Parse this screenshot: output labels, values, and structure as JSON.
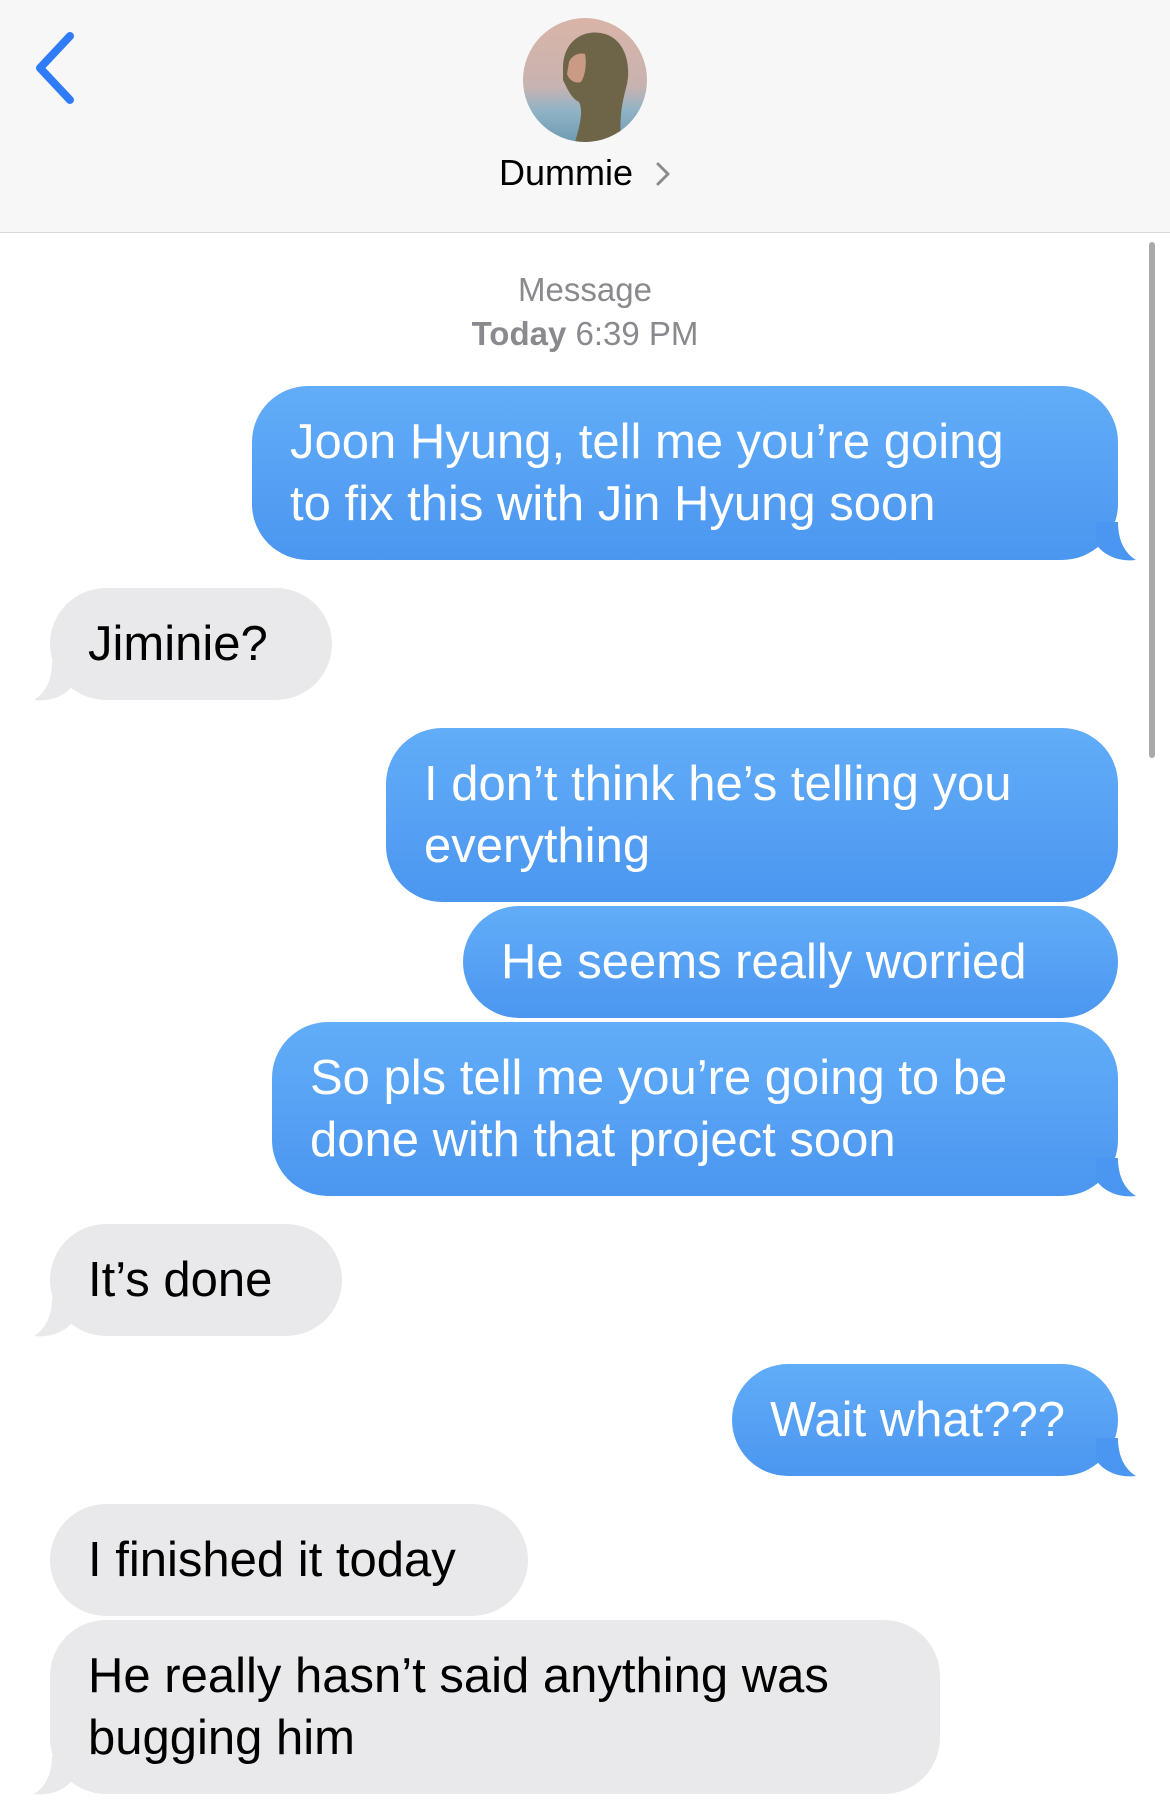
{
  "header": {
    "contact_name": "Dummie",
    "back_icon": "chevron-left-icon",
    "detail_icon": "chevron-right-icon"
  },
  "thread": {
    "service_label": "Message",
    "day_label": "Today",
    "time_label": "6:39 PM"
  },
  "colors": {
    "sent_bubble": "#4b96f0",
    "received_bubble": "#e9e9eb",
    "accent": "#1a73e8"
  },
  "messages": [
    {
      "from": "me",
      "lines": [
        "Joon Hyung, tell me you’re going",
        "to fix this with Jin Hyung soon"
      ]
    },
    {
      "from": "them",
      "lines": [
        "Jiminie?"
      ]
    },
    {
      "from": "me",
      "lines": [
        "I don’t think he’s telling you",
        "everything"
      ]
    },
    {
      "from": "me",
      "lines": [
        "He seems really worried"
      ]
    },
    {
      "from": "me",
      "lines": [
        "So pls tell me you’re going to be",
        "done with that project soon"
      ]
    },
    {
      "from": "them",
      "lines": [
        "It’s done"
      ]
    },
    {
      "from": "me",
      "lines": [
        "Wait what???"
      ]
    },
    {
      "from": "them",
      "lines": [
        "I finished it today"
      ]
    },
    {
      "from": "them",
      "lines": [
        "He really hasn’t said anything was",
        "bugging him"
      ]
    }
  ]
}
